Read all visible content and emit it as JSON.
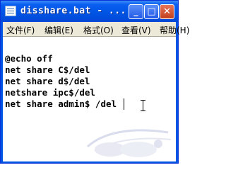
{
  "window": {
    "title": "disshare.bat - ...",
    "buttons": {
      "minimize": "_",
      "maximize": "□",
      "close": "✕"
    }
  },
  "menu": {
    "items": [
      {
        "label": "文件(F)"
      },
      {
        "label": "编辑(E)"
      },
      {
        "label": "格式(O)"
      },
      {
        "label": "查看(V)"
      },
      {
        "label": "帮助(H)"
      }
    ]
  },
  "editor": {
    "lines": [
      "@echo off",
      "net share C$/del",
      "net share d$/del",
      "netshare ipc$/del",
      "net share admin$ /del"
    ]
  },
  "icons": {
    "app": "notepad-icon",
    "cursor": "text-cursor-icon",
    "watermark": "site-logo-watermark"
  },
  "colors": {
    "titlebar": "#0054e3",
    "menubar": "#ece9d8",
    "close": "#d6532e"
  }
}
